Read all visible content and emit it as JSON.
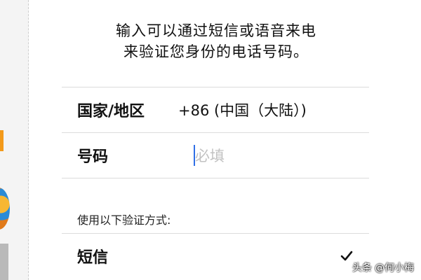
{
  "intro": {
    "line1": "输入可以通过短信或语音来电",
    "line2": "来验证您身份的电话号码。"
  },
  "form": {
    "country_label": "国家/地区",
    "country_value": "+86 (中国（大陆）)",
    "phone_label": "号码",
    "phone_placeholder": "必填",
    "phone_value": ""
  },
  "verification": {
    "section_label": "使用以下验证方式:",
    "sms_label": "短信",
    "sms_selected": true
  },
  "watermark": {
    "source": "头条",
    "author": "@何小梅"
  },
  "colors": {
    "caret": "#2f6fe6",
    "divider": "#dcdcdc",
    "placeholder": "#c2c2c2"
  }
}
